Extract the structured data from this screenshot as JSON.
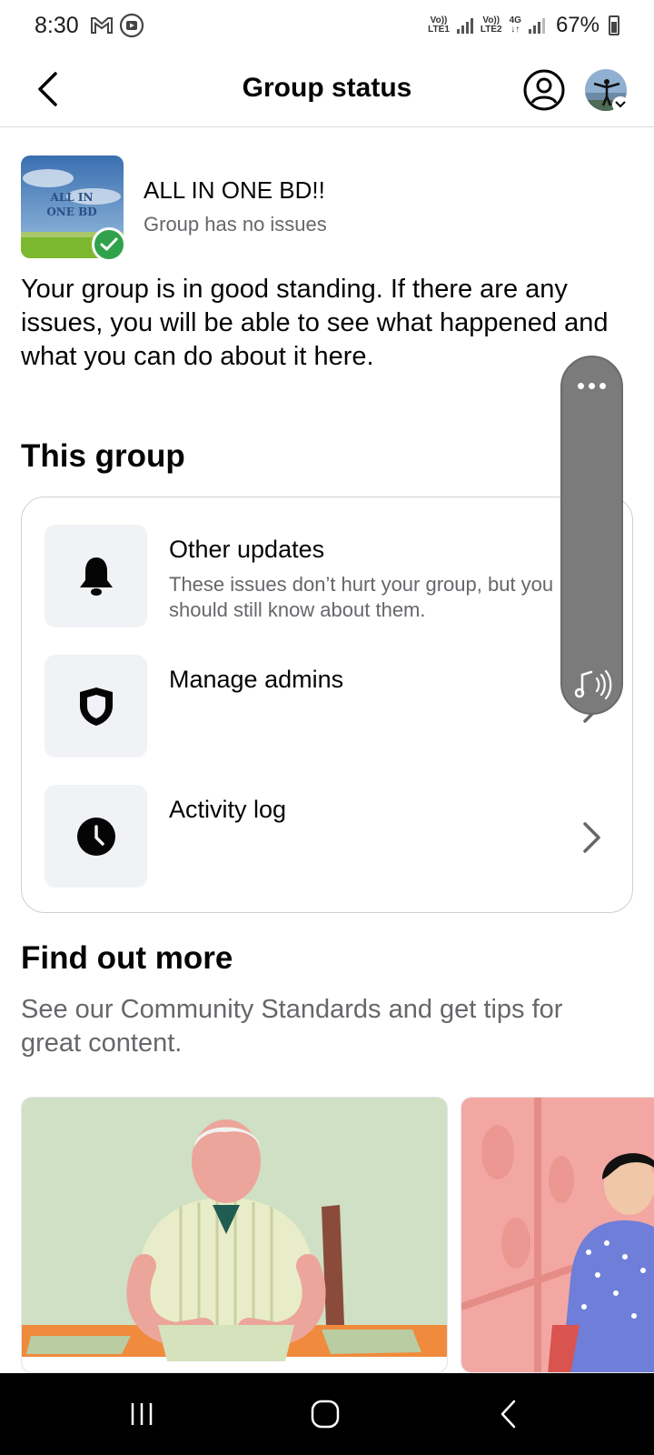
{
  "status_bar": {
    "time": "8:30",
    "sim1_label_top": "Vo))",
    "sim1_label_bottom": "LTE1",
    "sim2_label_top": "Vo))",
    "sim2_label_bottom": "LTE2",
    "network": "4G",
    "battery": "67%"
  },
  "header": {
    "title": "Group status"
  },
  "group": {
    "name": "ALL IN ONE BD!!",
    "status": "Group has no issues",
    "thumb_text_line1": "ALL IN",
    "thumb_text_line2": "ONE BD",
    "standing_message": "Your group is in good standing. If there are any issues, you will be able to see what happened and what you can do about it here."
  },
  "this_group": {
    "heading": "This group",
    "items": [
      {
        "title": "Other updates",
        "description": "These issues don’t hurt your group, but you should still know about them.",
        "icon": "bell-icon"
      },
      {
        "title": "Manage admins",
        "description": "",
        "icon": "shield-icon"
      },
      {
        "title": "Activity log",
        "description": "",
        "icon": "clock-icon"
      }
    ]
  },
  "find_out_more": {
    "heading": "Find out more",
    "subtitle": "See our Community Standards and get tips for great content."
  },
  "colors": {
    "primary_text": "#050505",
    "secondary_text": "#65676b",
    "success_green": "#31a24c",
    "icon_bg": "#f0f2f5",
    "card_border": "#ced0d4"
  }
}
